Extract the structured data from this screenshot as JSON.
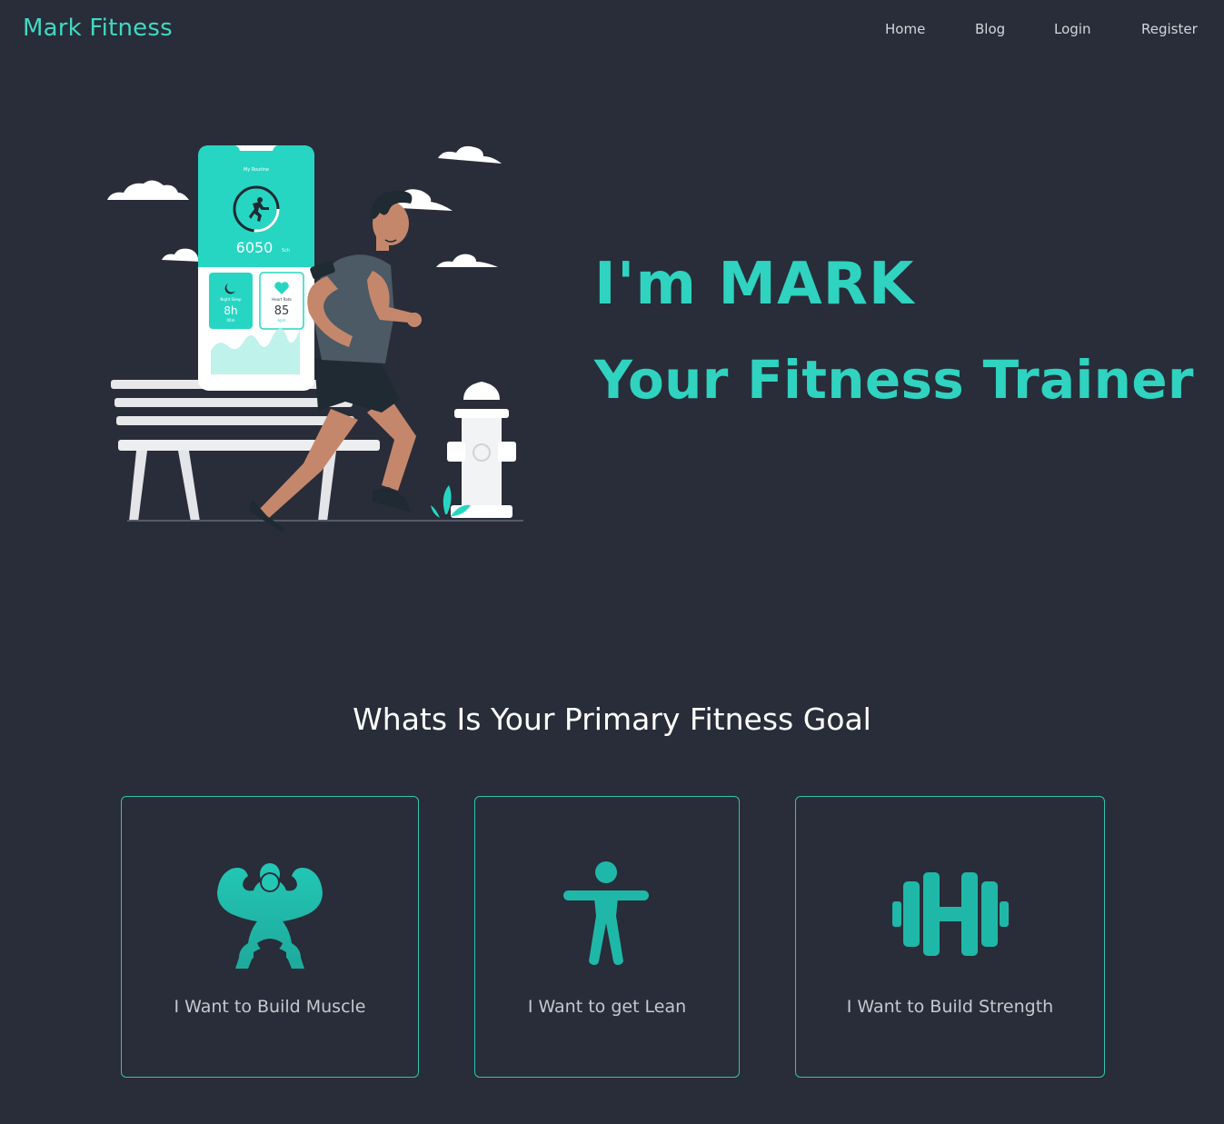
{
  "navbar": {
    "brand": "Mark Fitness",
    "links": [
      {
        "label": "Home"
      },
      {
        "label": "Blog"
      },
      {
        "label": "Login"
      },
      {
        "label": "Register"
      }
    ]
  },
  "hero": {
    "line1": "I'm MARK",
    "line2": "Your Fitness Trainer",
    "illustration": {
      "app_title": "My Routine",
      "steps_value": "6050",
      "steps_unit": "Sch",
      "sleep_title": "Night Sleep",
      "sleep_value": "8h",
      "sleep_unit": "00m",
      "heart_title": "Heart Rate",
      "heart_value": "85",
      "heart_unit": "bpm"
    }
  },
  "goals": {
    "heading": "Whats Is Your Primary Fitness Goal",
    "cards": [
      {
        "label": "I Want to Build Muscle",
        "icon": "muscle-icon"
      },
      {
        "label": "I Want to get Lean",
        "icon": "lean-person-icon"
      },
      {
        "label": "I Want to Build Strength",
        "icon": "dumbbell-icon"
      }
    ]
  },
  "colors": {
    "background": "#282d39",
    "accent": "#2fd3c0",
    "brand": "#41d8c2",
    "card_border": "#2fc4b1",
    "nav_text": "#d3d6dc",
    "card_label": "#c4c8cf"
  }
}
